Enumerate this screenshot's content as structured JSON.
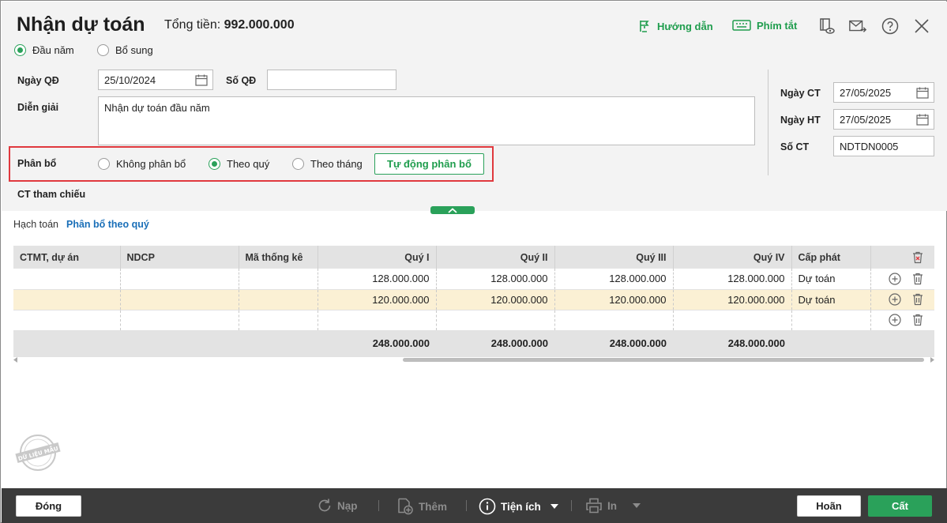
{
  "header": {
    "title": "Nhận dự toán",
    "total_label": "Tổng tiền:",
    "total_value": "992.000.000",
    "guide_label": "Hướng dẫn",
    "shortcut_label": "Phím tắt"
  },
  "type_options": {
    "dau_nam": "Đầu năm",
    "bo_sung": "Bổ sung",
    "selected": "Đầu năm"
  },
  "form": {
    "ngay_qd_label": "Ngày QĐ",
    "ngay_qd_value": "25/10/2024",
    "so_qd_label": "Số QĐ",
    "so_qd_value": "",
    "dien_giai_label": "Diễn giải",
    "dien_giai_value": "Nhận dự toán đầu năm",
    "phan_bo_label": "Phân bổ",
    "phan_bo_options": [
      "Không phân bổ",
      "Theo quý",
      "Theo tháng"
    ],
    "phan_bo_selected": "Theo quý",
    "auto_button": "Tự động phân bổ",
    "ct_tham_chieu_label": "CT tham chiếu",
    "ngay_ct_label": "Ngày CT",
    "ngay_ct_value": "27/05/2025",
    "ngay_ht_label": "Ngày HT",
    "ngay_ht_value": "27/05/2025",
    "so_ct_label": "Số CT",
    "so_ct_value": "NDTDN0005"
  },
  "tabs": {
    "items": [
      "Hạch toán",
      "Phân bổ theo quý"
    ],
    "active": "Phân bổ theo quý"
  },
  "table": {
    "columns": [
      "CTMT, dự án",
      "NDCP",
      "Mã thống kê",
      "Quý I",
      "Quý II",
      "Quý III",
      "Quý IV",
      "Cấp phát"
    ],
    "rows": [
      {
        "ctmt": "",
        "ndcp": "",
        "ma_thong_ke": "",
        "q1": "128.000.000",
        "q2": "128.000.000",
        "q3": "128.000.000",
        "q4": "128.000.000",
        "cap_phat": "Dự toán",
        "selected": false
      },
      {
        "ctmt": "",
        "ndcp": "",
        "ma_thong_ke": "",
        "q1": "120.000.000",
        "q2": "120.000.000",
        "q3": "120.000.000",
        "q4": "120.000.000",
        "cap_phat": "Dự toán",
        "selected": true
      },
      {
        "ctmt": "",
        "ndcp": "",
        "ma_thong_ke": "",
        "q1": "",
        "q2": "",
        "q3": "",
        "q4": "",
        "cap_phat": "",
        "selected": false
      }
    ],
    "totals": {
      "q1": "248.000.000",
      "q2": "248.000.000",
      "q3": "248.000.000",
      "q4": "248.000.000"
    }
  },
  "watermark": "DỮ LIỆU MẪU",
  "footer": {
    "close": "Đóng",
    "reload": "Nạp",
    "add": "Thêm",
    "utilities": "Tiện ích",
    "print": "In",
    "cancel": "Hoãn",
    "save": "Cất"
  },
  "colors": {
    "accent": "#2aa15a",
    "highlight_box": "#e0393e",
    "tab_active": "#1a6fb8",
    "selected_row": "#fbf0d4"
  }
}
